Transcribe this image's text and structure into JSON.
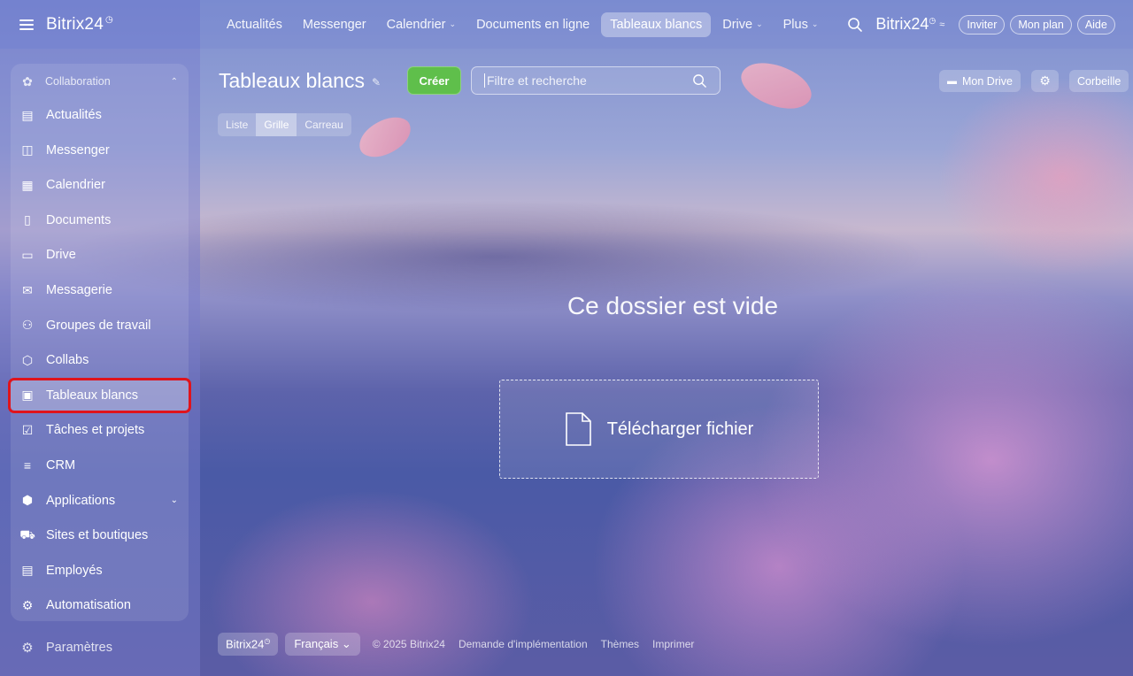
{
  "header": {
    "brand": "Bitrix24",
    "brand_mark": "◷",
    "nav": [
      {
        "label": "Actualités",
        "dropdown": false,
        "active": false
      },
      {
        "label": "Messenger",
        "dropdown": false,
        "active": false
      },
      {
        "label": "Calendrier",
        "dropdown": true,
        "active": false
      },
      {
        "label": "Documents en ligne",
        "dropdown": false,
        "active": false
      },
      {
        "label": "Tableaux blancs",
        "dropdown": false,
        "active": true
      },
      {
        "label": "Drive",
        "dropdown": true,
        "active": false
      },
      {
        "label": "Plus",
        "dropdown": true,
        "active": false
      }
    ],
    "brand_right": "Bitrix24",
    "buttons": {
      "invite": "Inviter",
      "plan": "Mon plan",
      "help": "Aide"
    }
  },
  "sidebar": {
    "group_label": "Collaboration",
    "items": [
      {
        "label": "Actualités",
        "icon": "news-icon",
        "glyph": "▤"
      },
      {
        "label": "Messenger",
        "icon": "chat-icon",
        "glyph": "◫"
      },
      {
        "label": "Calendrier",
        "icon": "calendar-icon",
        "glyph": "▦"
      },
      {
        "label": "Documents",
        "icon": "document-icon",
        "glyph": "▯"
      },
      {
        "label": "Drive",
        "icon": "drive-icon",
        "glyph": "▭"
      },
      {
        "label": "Messagerie",
        "icon": "mail-icon",
        "glyph": "✉"
      },
      {
        "label": "Groupes de travail",
        "icon": "group-icon",
        "glyph": "⚇"
      },
      {
        "label": "Collabs",
        "icon": "hexagon-icon",
        "glyph": "⬡"
      },
      {
        "label": "Tableaux blancs",
        "icon": "whiteboard-icon",
        "glyph": "▣",
        "active": true
      },
      {
        "label": "Tâches et projets",
        "icon": "checkbox-icon",
        "glyph": "☑"
      },
      {
        "label": "CRM",
        "icon": "funnel-icon",
        "glyph": "≡"
      },
      {
        "label": "Applications",
        "icon": "cube-icon",
        "glyph": "⬢",
        "expandable": true
      },
      {
        "label": "Sites et boutiques",
        "icon": "cart-icon",
        "glyph": "⛟"
      },
      {
        "label": "Employés",
        "icon": "id-card-icon",
        "glyph": "▤"
      },
      {
        "label": "Automatisation",
        "icon": "robot-icon",
        "glyph": "⚙"
      }
    ],
    "settings_label": "Paramètres"
  },
  "main": {
    "title": "Tableaux blancs",
    "create_label": "Créer",
    "search_placeholder": "Filtre et recherche",
    "views": [
      {
        "label": "Liste",
        "active": false
      },
      {
        "label": "Grille",
        "active": true
      },
      {
        "label": "Carreau",
        "active": false
      }
    ],
    "my_drive_label": "Mon Drive",
    "trash_label": "Corbeille",
    "empty_message": "Ce dossier est vide",
    "upload_label": "Télécharger fichier"
  },
  "footer": {
    "brand": "Bitrix24",
    "language": "Français",
    "copyright": "© 2025 Bitrix24",
    "links": [
      "Demande d'implémentation",
      "Thèmes",
      "Imprimer"
    ]
  },
  "colors": {
    "create_button": "#5fbf4b",
    "active_highlight": "#e0141c"
  }
}
